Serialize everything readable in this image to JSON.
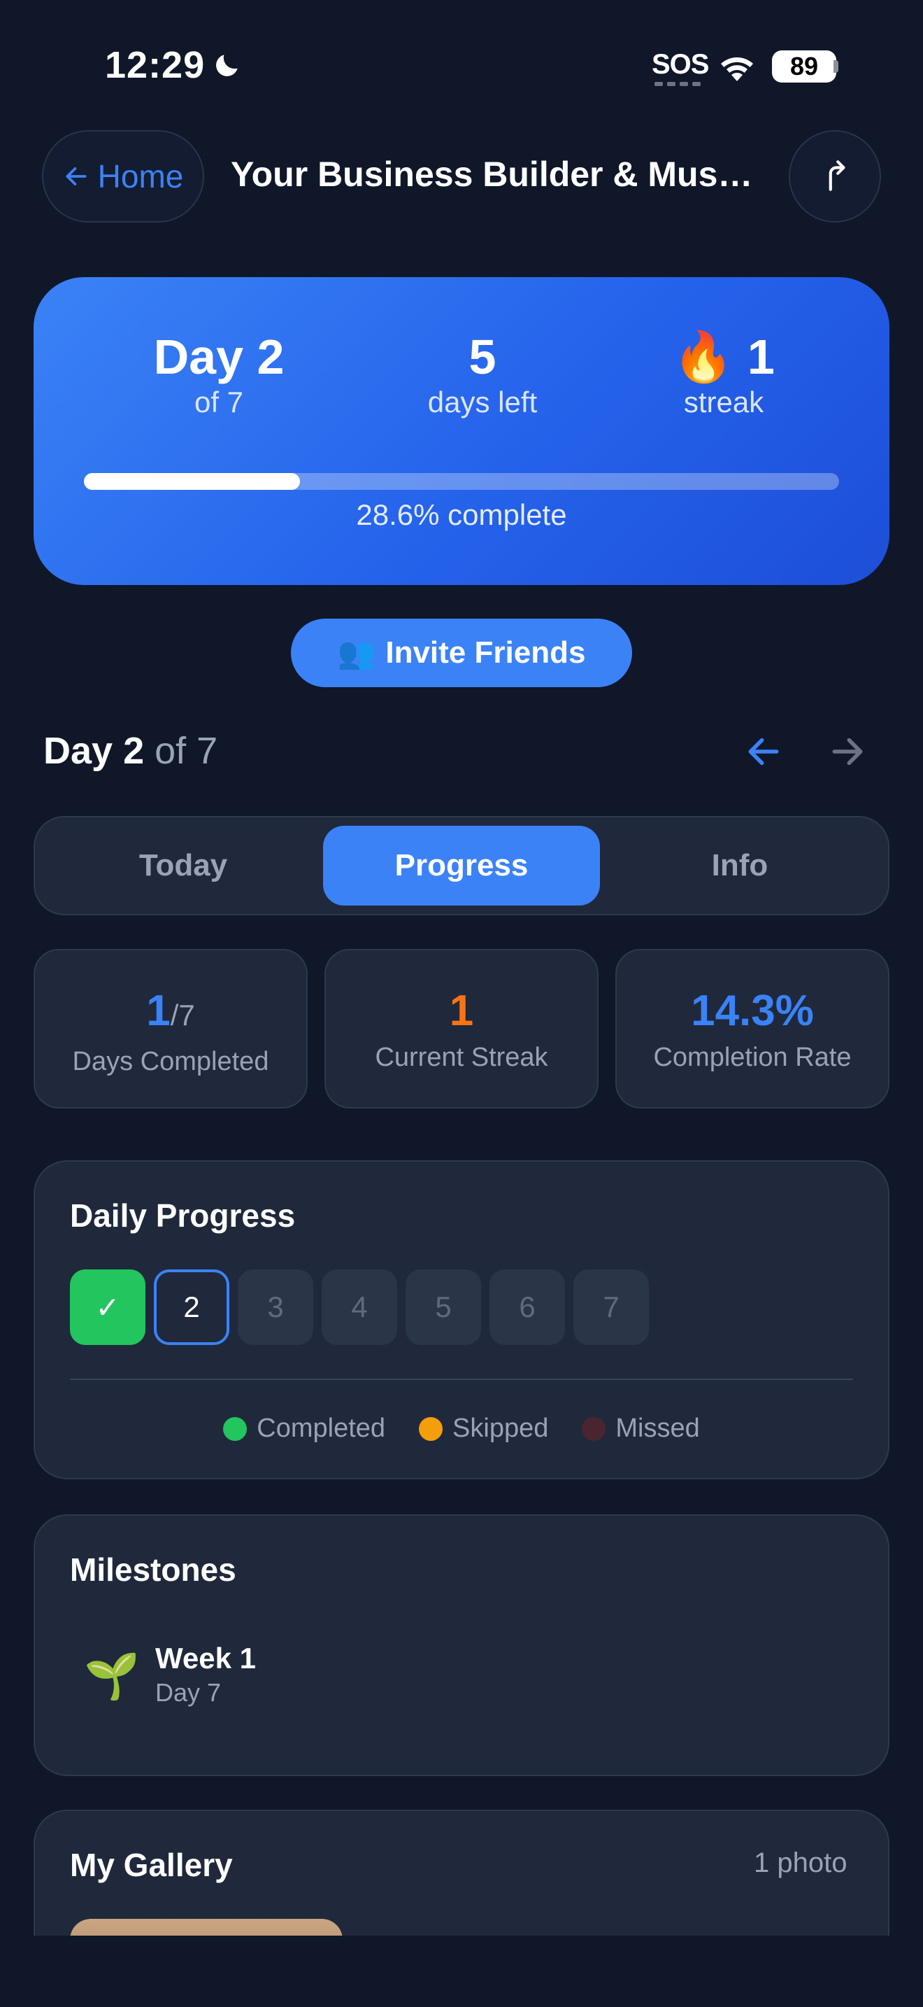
{
  "status_bar": {
    "time": "12:29",
    "sos": "SOS",
    "battery": "89"
  },
  "nav": {
    "back_label": "Home",
    "title": "Your Business Builder & Musc..."
  },
  "hero": {
    "day_value": "Day 2",
    "day_sub": "of 7",
    "days_left_value": "5",
    "days_left_sub": "days left",
    "streak_value": "1",
    "streak_emoji": "🔥",
    "streak_sub": "streak",
    "progress_fraction": 0.286,
    "progress_text": "28.6% complete"
  },
  "invite": {
    "icon": "👥",
    "label": "Invite Friends"
  },
  "day_header": {
    "day": "Day 2",
    "of": "of 7"
  },
  "tabs": [
    {
      "label": "Today",
      "active": false
    },
    {
      "label": "Progress",
      "active": true
    },
    {
      "label": "Info",
      "active": false
    }
  ],
  "stats": {
    "days_completed_value": "1",
    "days_completed_denom": "/7",
    "days_completed_label": "Days Completed",
    "streak_value": "1",
    "streak_label": "Current Streak",
    "rate_value": "14.3%",
    "rate_label": "Completion Rate"
  },
  "daily_progress": {
    "title": "Daily Progress",
    "days": [
      {
        "label": "✓",
        "state": "completed"
      },
      {
        "label": "2",
        "state": "current"
      },
      {
        "label": "3",
        "state": "upcoming"
      },
      {
        "label": "4",
        "state": "upcoming"
      },
      {
        "label": "5",
        "state": "upcoming"
      },
      {
        "label": "6",
        "state": "upcoming"
      },
      {
        "label": "7",
        "state": "upcoming"
      }
    ],
    "legend": {
      "completed": "Completed",
      "skipped": "Skipped",
      "missed": "Missed"
    }
  },
  "milestones": {
    "title": "Milestones",
    "items": [
      {
        "icon": "🌱",
        "title": "Week 1",
        "subtitle": "Day 7"
      }
    ]
  },
  "gallery": {
    "title": "My Gallery",
    "count": "1 photo"
  },
  "colors": {
    "background": "#0f1729",
    "card": "#1f293b",
    "accent": "#3b82f6",
    "streak": "#f97316",
    "completed": "#22c55e",
    "skipped": "#f59e0b",
    "missed": "#4a2530"
  }
}
